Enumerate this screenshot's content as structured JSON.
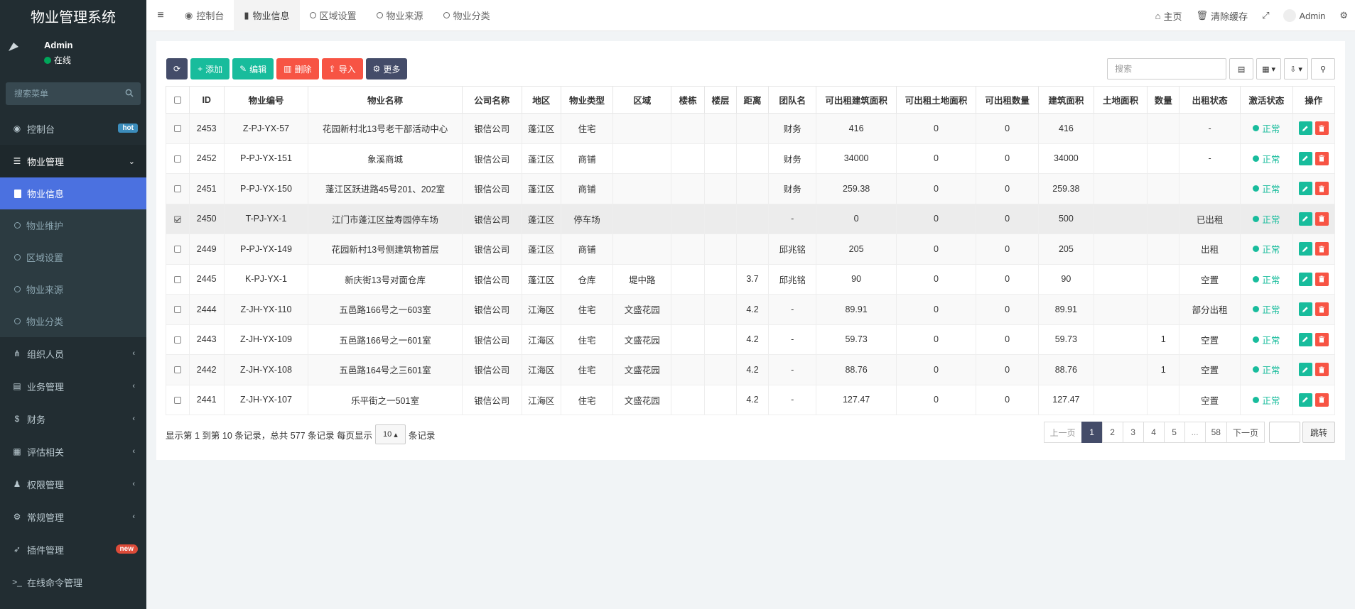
{
  "sidebar": {
    "logo": "物业管理系统",
    "user_name": "Admin",
    "user_status": "在线",
    "search_placeholder": "搜索菜单",
    "items": [
      {
        "label": "控制台",
        "badge": "hot"
      },
      {
        "label": "物业管理"
      },
      {
        "label": "组织人员"
      },
      {
        "label": "业务管理"
      },
      {
        "label": "财务"
      },
      {
        "label": "评估相关"
      },
      {
        "label": "权限管理"
      },
      {
        "label": "常规管理"
      },
      {
        "label": "插件管理",
        "badge": "new"
      },
      {
        "label": "在线命令管理"
      }
    ],
    "submenu": [
      "物业信息",
      "物业维护",
      "区域设置",
      "物业来源",
      "物业分类"
    ]
  },
  "topbar": {
    "tabs": [
      "控制台",
      "物业信息",
      "区域设置",
      "物业来源",
      "物业分类"
    ],
    "home": "主页",
    "clear_cache": "清除缓存",
    "user": "Admin"
  },
  "toolbar": {
    "add": "添加",
    "edit": "编辑",
    "delete": "删除",
    "import": "导入",
    "more": "更多",
    "search_placeholder": "搜索"
  },
  "table": {
    "headers": [
      "ID",
      "物业编号",
      "物业名称",
      "公司名称",
      "地区",
      "物业类型",
      "区域",
      "楼栋",
      "楼层",
      "距离",
      "团队名",
      "可出租建筑面积",
      "可出租土地面积",
      "可出租数量",
      "建筑面积",
      "土地面积",
      "数量",
      "出租状态",
      "激活状态",
      "操作"
    ],
    "rows": [
      {
        "checked": false,
        "cells": [
          "2453",
          "Z-PJ-YX-57",
          "花园新村北13号老干部活动中心",
          "银信公司",
          "蓬江区",
          "住宅",
          "",
          "",
          "",
          "",
          "财务",
          "416",
          "0",
          "0",
          "416",
          "",
          "",
          "-",
          "正常"
        ]
      },
      {
        "checked": false,
        "cells": [
          "2452",
          "P-PJ-YX-151",
          "象溪商城",
          "银信公司",
          "蓬江区",
          "商铺",
          "",
          "",
          "",
          "",
          "财务",
          "34000",
          "0",
          "0",
          "34000",
          "",
          "",
          "-",
          "正常"
        ]
      },
      {
        "checked": false,
        "cells": [
          "2451",
          "P-PJ-YX-150",
          "蓬江区跃进路45号201、202室",
          "银信公司",
          "蓬江区",
          "商铺",
          "",
          "",
          "",
          "",
          "财务",
          "259.38",
          "0",
          "0",
          "259.38",
          "",
          "",
          "",
          "正常"
        ]
      },
      {
        "checked": true,
        "cells": [
          "2450",
          "T-PJ-YX-1",
          "江门市蓬江区益寿园停车场",
          "银信公司",
          "蓬江区",
          "停车场",
          "",
          "",
          "",
          "",
          "-",
          "0",
          "0",
          "0",
          "500",
          "",
          "",
          "已出租",
          "正常"
        ]
      },
      {
        "checked": false,
        "cells": [
          "2449",
          "P-PJ-YX-149",
          "花园新村13号侧建筑物首层",
          "银信公司",
          "蓬江区",
          "商铺",
          "",
          "",
          "",
          "",
          "邱兆铭",
          "205",
          "0",
          "0",
          "205",
          "",
          "",
          "出租",
          "正常"
        ]
      },
      {
        "checked": false,
        "cells": [
          "2445",
          "K-PJ-YX-1",
          "新庆街13号对面仓库",
          "银信公司",
          "蓬江区",
          "仓库",
          "堤中路",
          "",
          "",
          "3.7",
          "邱兆铭",
          "90",
          "0",
          "0",
          "90",
          "",
          "",
          "空置",
          "正常"
        ]
      },
      {
        "checked": false,
        "cells": [
          "2444",
          "Z-JH-YX-110",
          "五邑路166号之一603室",
          "银信公司",
          "江海区",
          "住宅",
          "文盛花园",
          "",
          "",
          "4.2",
          "-",
          "89.91",
          "0",
          "0",
          "89.91",
          "",
          "",
          "部分出租",
          "正常"
        ]
      },
      {
        "checked": false,
        "cells": [
          "2443",
          "Z-JH-YX-109",
          "五邑路166号之一601室",
          "银信公司",
          "江海区",
          "住宅",
          "文盛花园",
          "",
          "",
          "4.2",
          "-",
          "59.73",
          "0",
          "0",
          "59.73",
          "",
          "1",
          "空置",
          "正常"
        ]
      },
      {
        "checked": false,
        "cells": [
          "2442",
          "Z-JH-YX-108",
          "五邑路164号之三601室",
          "银信公司",
          "江海区",
          "住宅",
          "文盛花园",
          "",
          "",
          "4.2",
          "-",
          "88.76",
          "0",
          "0",
          "88.76",
          "",
          "1",
          "空置",
          "正常"
        ]
      },
      {
        "checked": false,
        "cells": [
          "2441",
          "Z-JH-YX-107",
          "乐平街之一501室",
          "银信公司",
          "江海区",
          "住宅",
          "文盛花园",
          "",
          "",
          "4.2",
          "-",
          "127.47",
          "0",
          "0",
          "127.47",
          "",
          "",
          "空置",
          "正常"
        ]
      }
    ]
  },
  "footer": {
    "info": "显示第 1 到第 10 条记录，总共 577 条记录 每页显示",
    "page_size": "10",
    "suffix": "条记录",
    "prev": "上一页",
    "pages": [
      "1",
      "2",
      "3",
      "4",
      "5",
      "...",
      "58"
    ],
    "next": "下一页",
    "jump": "跳转"
  },
  "colors": {
    "accent": "#4b71e0",
    "primary_btn": "#444c69",
    "success": "#18bc9c",
    "danger": "#f75444"
  }
}
